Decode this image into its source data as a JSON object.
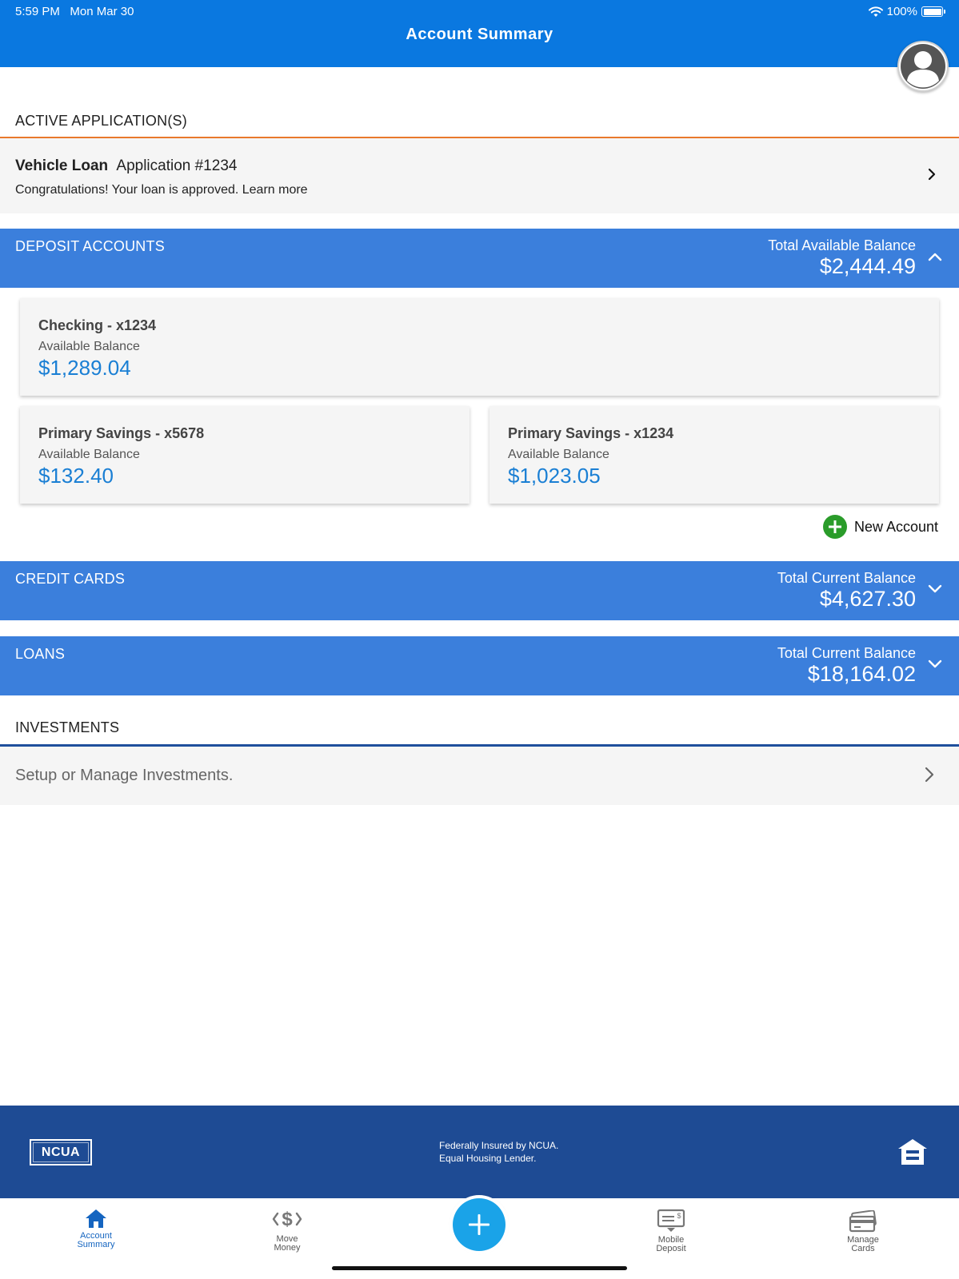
{
  "status_bar": {
    "time": "5:59 PM",
    "date": "Mon Mar 30",
    "battery": "100%",
    "battery_level": 1.0
  },
  "header": {
    "title": "Account Summary",
    "avatar_icon": "user-avatar-icon"
  },
  "active_applications": {
    "label": "ACTIVE APPLICATION(S)",
    "item": {
      "type": "Vehicle Loan",
      "number": "Application #1234",
      "message": "Congratulations! Your loan is approved. Learn more"
    }
  },
  "deposit_accounts": {
    "label": "DEPOSIT ACCOUNTS",
    "caption": "Total Available Balance",
    "total": "$2,444.49",
    "expanded": true,
    "accounts": [
      {
        "name": "Checking - x1234",
        "balance_label": "Available Balance",
        "balance": "$1,289.04"
      },
      {
        "name": "Primary Savings - x5678",
        "balance_label": "Available Balance",
        "balance": "$132.40"
      },
      {
        "name": "Primary Savings - x1234",
        "balance_label": "Available Balance",
        "balance": "$1,023.05"
      }
    ],
    "new_account_label": "New Account"
  },
  "credit_cards": {
    "label": "CREDIT CARDS",
    "caption": "Total Current Balance",
    "total": "$4,627.30",
    "expanded": false
  },
  "loans": {
    "label": "LOANS",
    "caption": "Total Current Balance",
    "total": "$18,164.02",
    "expanded": false
  },
  "investments": {
    "label": "INVESTMENTS",
    "row_text": "Setup or Manage Investments."
  },
  "footer": {
    "ncua_logo": "NCUA",
    "line1": "Federally Insured by NCUA.",
    "line2": "Equal Housing Lender."
  },
  "tabs": [
    {
      "line1": "Account",
      "line2": "Summary",
      "icon": "home-icon",
      "active": true
    },
    {
      "line1": "Move",
      "line2": "Money",
      "icon": "move-money-icon",
      "active": false
    },
    {
      "line1": "Mobile",
      "line2": "Deposit",
      "icon": "mobile-deposit-icon",
      "active": false
    },
    {
      "line1": "Manage",
      "line2": "Cards",
      "icon": "manage-cards-icon",
      "active": false
    }
  ],
  "colors": {
    "header_blue": "#0a78e0",
    "section_blue": "#3b7fdc",
    "footer_navy": "#1e4b94",
    "amount_blue": "#1a7fd4",
    "accent_orange": "#e9792c",
    "fab_blue": "#1aa3e8",
    "success_green": "#2a9c2a"
  }
}
